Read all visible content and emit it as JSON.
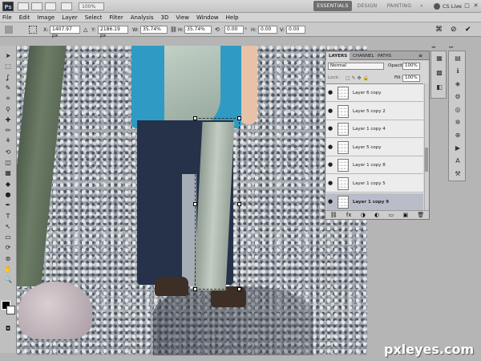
{
  "titlebar": {
    "logo": "Ps",
    "zoom_label": "100%",
    "workspaces": [
      "ESSENTIALS",
      "DESIGN",
      "PAINTING"
    ],
    "workspace_more": "»",
    "cs_live": "CS Live",
    "window_controls": [
      "–",
      "□",
      "✕"
    ]
  },
  "menubar": {
    "items": [
      "File",
      "Edit",
      "Image",
      "Layer",
      "Select",
      "Filter",
      "Analysis",
      "3D",
      "View",
      "Window",
      "Help"
    ]
  },
  "options": {
    "x_label": "X:",
    "x_value": "1407.97 px",
    "y_label": "Y:",
    "y_value": "2186.19 px",
    "w_label": "W:",
    "w_value": "35.74%",
    "h_label": "H:",
    "h_value": "35.74%",
    "angle_value": "0.00",
    "angle_unit": "°",
    "hskew_label": "H:",
    "hskew_value": "0.00",
    "vskew_label": "V:",
    "vskew_value": "0.00",
    "commit_icons": [
      "cancel-transform-icon",
      "commit-transform-icon"
    ]
  },
  "toolbar": {
    "tools": [
      "move-tool-icon",
      "marquee-tool-icon",
      "lasso-tool-icon",
      "quick-select-tool-icon",
      "crop-tool-icon",
      "eyedropper-tool-icon",
      "healing-brush-icon",
      "brush-tool-icon",
      "clone-stamp-icon",
      "history-brush-icon",
      "eraser-tool-icon",
      "gradient-tool-icon",
      "blur-tool-icon",
      "dodge-tool-icon",
      "pen-tool-icon",
      "type-tool-icon",
      "path-select-icon",
      "shape-tool-icon",
      "3d-rotate-icon",
      "3d-orbit-icon",
      "hand-tool-icon",
      "zoom-tool-icon"
    ],
    "tool_glyphs": [
      "➤",
      "⬚",
      "ʆ",
      "✎",
      "⌗",
      "⚲",
      "✚",
      "✏",
      "⚘",
      "⟲",
      "◫",
      "▦",
      "◆",
      "●",
      "✒",
      "T",
      "↖",
      "▭",
      "⟳",
      "⊛",
      "✋",
      "🔍"
    ],
    "quick_mask_glyph": "◘"
  },
  "layers_panel": {
    "tabs": [
      "LAYERS",
      "CHANNEL",
      "PATHS"
    ],
    "blend_mode": "Normal",
    "opacity_label": "Opacity:",
    "opacity_value": "100%",
    "lock_label": "Lock:",
    "fill_label": "Fill:",
    "fill_value": "100%",
    "rows": [
      {
        "name": "Layer 6 copy",
        "selected": false
      },
      {
        "name": "Layer 5 copy 2",
        "selected": false
      },
      {
        "name": "Layer 1 copy 4",
        "selected": false
      },
      {
        "name": "Layer 5 copy",
        "selected": false
      },
      {
        "name": "Layer 1 copy 8",
        "selected": false
      },
      {
        "name": "Layer 1 copy 5",
        "selected": false
      },
      {
        "name": "Layer 1 copy 9",
        "selected": true
      }
    ],
    "footer_icons": [
      "link-layers-icon",
      "layer-style-icon",
      "layer-mask-icon",
      "adjustment-layer-icon",
      "group-icon",
      "new-layer-icon",
      "delete-layer-icon"
    ],
    "footer_glyphs": [
      "⛓",
      "fx",
      "◑",
      "◐",
      "▭",
      "▣",
      "🗑"
    ]
  },
  "dock": {
    "left_icons": [
      "color-panel-icon",
      "swatches-panel-icon",
      "styles-panel-icon"
    ],
    "left_glyphs": [
      "▦",
      "▩",
      "◧"
    ],
    "right_icons": [
      "histogram-panel-icon",
      "info-panel-icon",
      "navigator-panel-icon",
      "adjustments-panel-icon",
      "masks-panel-icon",
      "brushes-panel-icon",
      "clone-source-icon",
      "actions-panel-icon",
      "character-panel-icon",
      "tool-presets-icon"
    ],
    "right_glyphs": [
      "▤",
      "ℹ",
      "◈",
      "⚙",
      "◎",
      "✲",
      "⊕",
      "▶",
      "A",
      "⚒"
    ]
  },
  "watermark": "pxleyes.com"
}
